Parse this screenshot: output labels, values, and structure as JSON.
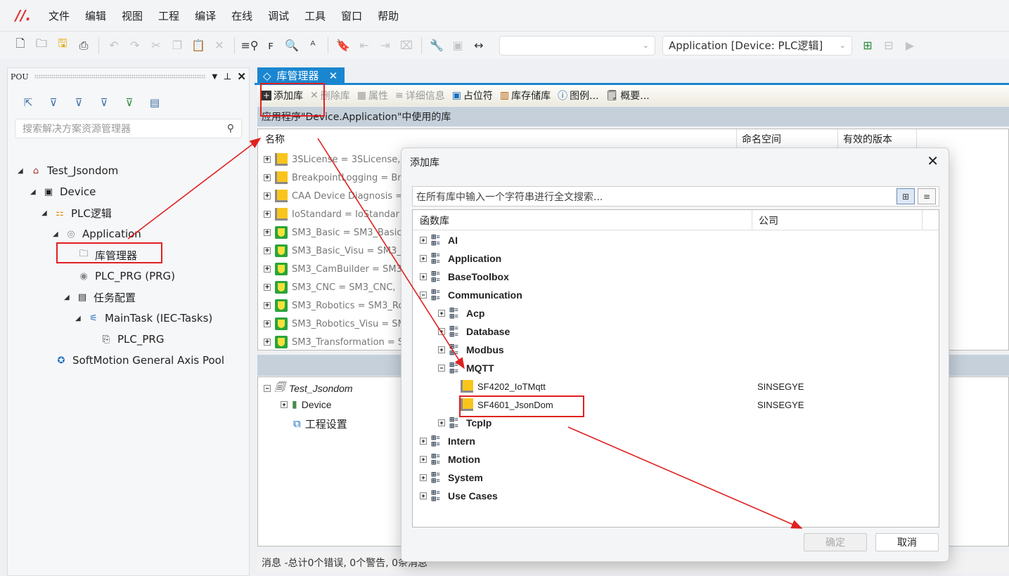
{
  "menu": [
    "文件",
    "编辑",
    "视图",
    "工程",
    "编译",
    "在线",
    "调试",
    "工具",
    "窗口",
    "帮助"
  ],
  "toolbar": {
    "combo1": "",
    "combo2": "Application [Device: PLC逻辑]"
  },
  "left_panel": {
    "title": "POU",
    "search_placeholder": "搜索解决方案资源管理器",
    "tree": [
      {
        "label": "Test_Jsondom",
        "icon": "project-icon"
      },
      {
        "label": "Device",
        "icon": "device-icon"
      },
      {
        "label": "PLC逻辑",
        "icon": "plc-logic-icon"
      },
      {
        "label": "Application",
        "icon": "application-icon"
      },
      {
        "label": "库管理器",
        "icon": "library-manager-icon"
      },
      {
        "label": "PLC_PRG (PRG)",
        "icon": "pou-icon"
      },
      {
        "label": "任务配置",
        "icon": "task-config-icon"
      },
      {
        "label": "MainTask (IEC-Tasks)",
        "icon": "task-icon"
      },
      {
        "label": "PLC_PRG",
        "icon": "program-call-icon"
      },
      {
        "label": "SoftMotion General Axis Pool",
        "icon": "axis-pool-icon"
      }
    ]
  },
  "tab": {
    "label": "库管理器"
  },
  "lib_toolbar": {
    "add": "添加库",
    "delete": "删除库",
    "properties": "属性",
    "details": "详细信息",
    "placeholder": "占位符",
    "repository": "库存储库",
    "legend": "图例...",
    "summary": "概要..."
  },
  "app_bar": "应用程序\"Device.Application\"中使用的库",
  "lib_table": {
    "headers": [
      "名称",
      "命名空间",
      "有效的版本"
    ],
    "rows": [
      {
        "name": "3SLicense = 3SLicense,",
        "type": "folder"
      },
      {
        "name": "BreakpointLogging = Bre",
        "type": "folder"
      },
      {
        "name": "CAA Device Diagnosis =",
        "type": "folder"
      },
      {
        "name": "IoStandard = IoStandar",
        "type": "folder"
      },
      {
        "name": "SM3_Basic = SM3_Basic,",
        "type": "shield"
      },
      {
        "name": "SM3_Basic_Visu = SM3_",
        "type": "shield"
      },
      {
        "name": "SM3_CamBuilder = SM3_",
        "type": "shield"
      },
      {
        "name": "SM3_CNC = SM3_CNC,",
        "type": "shield"
      },
      {
        "name": "SM3_Robotics = SM3_Ro",
        "type": "shield"
      },
      {
        "name": "SM3_Robotics_Visu = SM",
        "type": "shield"
      },
      {
        "name": "SM3_Transformation = S",
        "type": "shield"
      }
    ]
  },
  "project_tree": {
    "root": "Test_Jsondom",
    "device": "Device",
    "settings": "工程设置"
  },
  "messages": "消息 -总计0个错误, 0个警告, 0条消息",
  "dialog": {
    "title": "添加库",
    "search_placeholder": "在所有库中输入一个字符串进行全文搜索...",
    "headers": [
      "函数库",
      "公司"
    ],
    "nodes": [
      {
        "label": "AI",
        "level": 0,
        "state": "+"
      },
      {
        "label": "Application",
        "level": 0,
        "state": "+"
      },
      {
        "label": "BaseToolbox",
        "level": 0,
        "state": "+"
      },
      {
        "label": "Communication",
        "level": 0,
        "state": "-"
      },
      {
        "label": "Acp",
        "level": 1,
        "state": "+"
      },
      {
        "label": "Database",
        "level": 1,
        "state": "+"
      },
      {
        "label": "Modbus",
        "level": 1,
        "state": "+"
      },
      {
        "label": "MQTT",
        "level": 1,
        "state": "-"
      },
      {
        "label": "SF4202_IoTMqtt",
        "level": 2,
        "leaf": true,
        "company": "SINSEGYE"
      },
      {
        "label": "SF4601_JsonDom",
        "level": 2,
        "leaf": true,
        "company": "SINSEGYE"
      },
      {
        "label": "TcpIp",
        "level": 1,
        "state": "+"
      },
      {
        "label": "Intern",
        "level": 0,
        "state": "+"
      },
      {
        "label": "Motion",
        "level": 0,
        "state": "+"
      },
      {
        "label": "System",
        "level": 0,
        "state": "+"
      },
      {
        "label": "Use Cases",
        "level": 0,
        "state": "+"
      }
    ],
    "ok": "确定",
    "cancel": "取消"
  },
  "colors": {
    "accent": "#1a86d0",
    "annotation": "#e02020",
    "folder": "#f9c51c"
  }
}
